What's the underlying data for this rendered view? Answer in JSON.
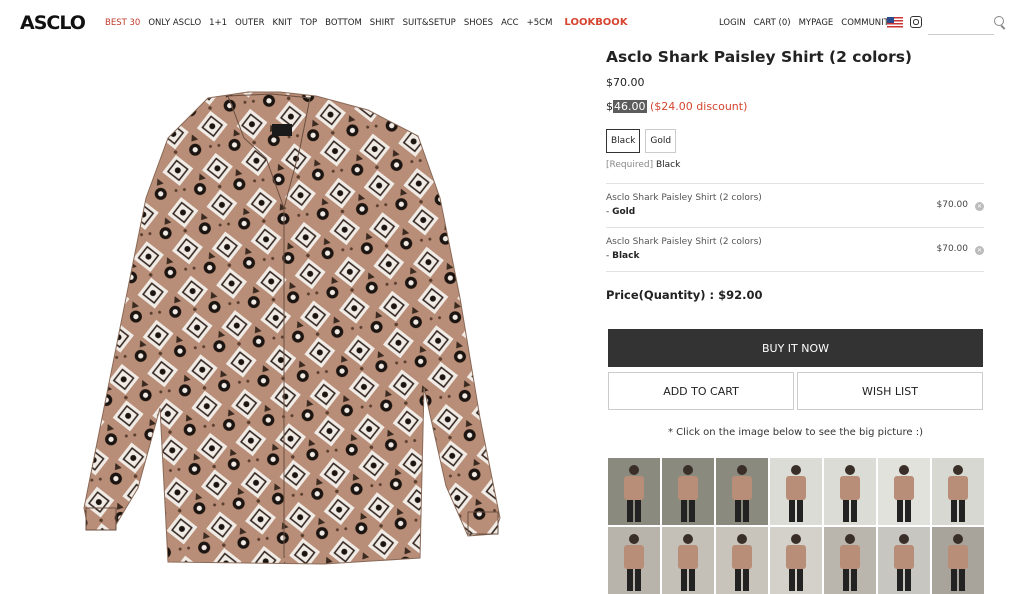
{
  "brand": {
    "logo": "ASCLO"
  },
  "nav": {
    "items": [
      "BEST 30",
      "ONLY ASCLO",
      "1+1",
      "OUTER",
      "KNIT",
      "TOP",
      "BOTTOM",
      "SHIRT",
      "SUIT&SETUP",
      "SHOES",
      "ACC",
      "+5CM"
    ],
    "lookbook": "LOOKBOOK"
  },
  "util": {
    "login": "LOGIN",
    "cart": "CART (0)",
    "mypage": "MYPAGE",
    "community": "COMMUNITY"
  },
  "icons": {
    "flag": "us-flag-icon",
    "instagram": "instagram-icon",
    "search": "search-icon"
  },
  "search": {
    "value": "",
    "placeholder": ""
  },
  "product": {
    "title": "Asclo Shark Paisley Shirt (2 colors)",
    "original_price": "$70.00",
    "sale_currency": "$",
    "sale_amount": "46.00",
    "discount": "($24.00 discount)",
    "options": [
      "Black",
      "Gold"
    ],
    "required_label": "[Required]",
    "required_value": "Black"
  },
  "selections": [
    {
      "name": "Asclo Shark Paisley Shirt (2 colors)",
      "dash": "- ",
      "color": "Gold",
      "price": "$70.00"
    },
    {
      "name": "Asclo Shark Paisley Shirt (2 colors)",
      "dash": "- ",
      "color": "Black",
      "price": "$70.00"
    }
  ],
  "total": {
    "label": "Price(Quantity) : ",
    "value": "$92.00"
  },
  "buttons": {
    "buy": "BUY IT NOW",
    "cart": "ADD TO CART",
    "wish": "WISH LIST"
  },
  "note": "* Click on the image below to see the big picture :)",
  "colors": {
    "accent": "#d6452f",
    "dark_button": "#333333",
    "shirt_base": "#b98e78"
  },
  "thumbnails_count": 14
}
